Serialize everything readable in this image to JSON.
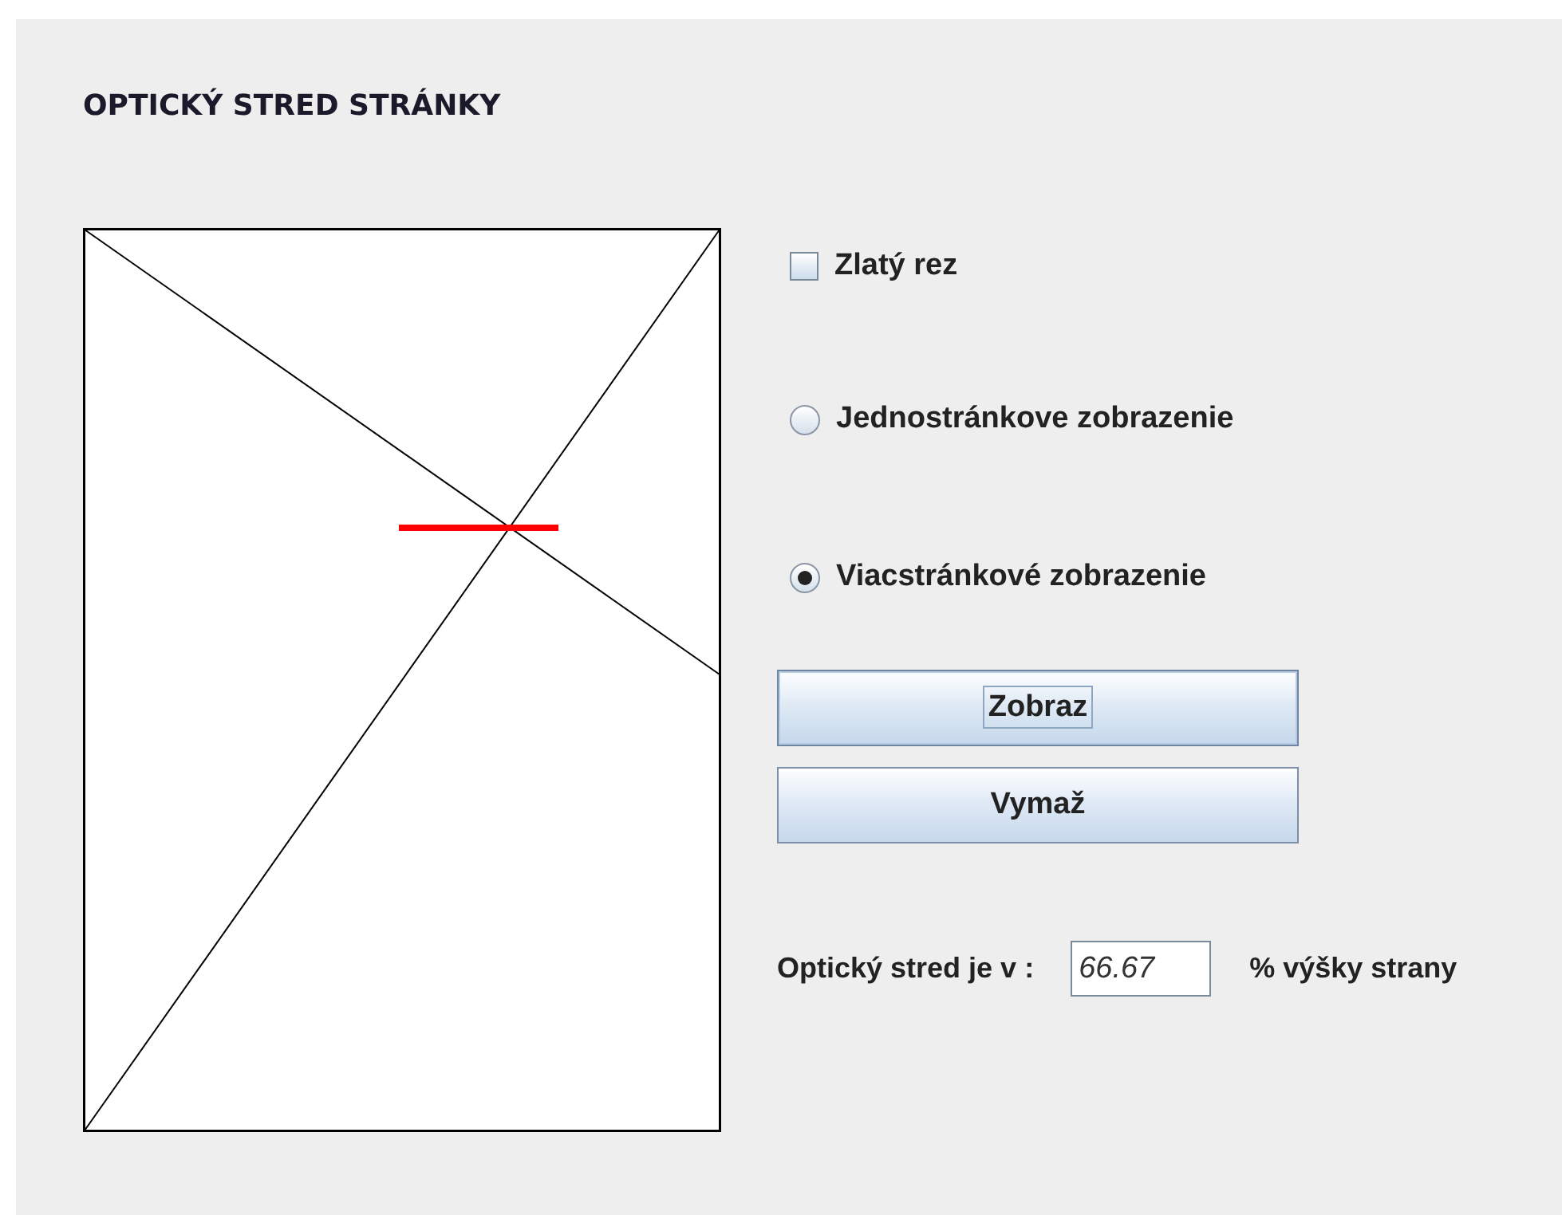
{
  "title": "OPTICKÝ STRED STRÁNKY",
  "checkbox": {
    "label": "Zlatý rez",
    "checked": false
  },
  "radios": [
    {
      "label": "Jednostránkove zobrazenie",
      "selected": false
    },
    {
      "label": "Viacstránkové zobrazenie",
      "selected": true
    }
  ],
  "buttons": [
    {
      "label": "Zobraz",
      "focused": true
    },
    {
      "label": "Vymaž",
      "focused": false
    }
  ],
  "result": {
    "label": "Optický stred je v :",
    "value": "66.67",
    "suffix": "% výšky strany"
  }
}
